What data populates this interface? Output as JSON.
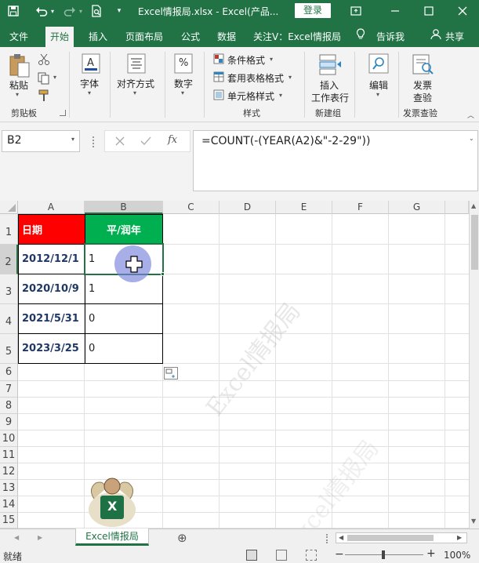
{
  "titlebar": {
    "title": "Excel情报局.xlsx  -  Excel(产品...",
    "login": "登录"
  },
  "tabs": [
    "文件",
    "开始",
    "插入",
    "页面布局",
    "公式",
    "数据",
    "关注V：Excel情报局",
    "告诉我",
    "共享"
  ],
  "ribbon": {
    "paste": "粘贴",
    "clipboard": "剪贴板",
    "font": "字体",
    "align": "对齐方式",
    "number": "数字",
    "number_glyph": "%",
    "cond_format": "条件格式",
    "table_format": "套用表格格式",
    "cell_style": "单元格样式",
    "styles": "样式",
    "insert_worksheet": "插入",
    "insert_worksheet2": "工作表行",
    "newbuild": "新建组",
    "edit": "编辑",
    "invoice1": "发票",
    "invoice2": "查验",
    "invoice_group": "发票查验"
  },
  "formula_bar": {
    "namebox": "B2",
    "formula": "=COUNT(-(YEAR(A2)&\"-2-29\"))"
  },
  "columns": [
    "A",
    "B",
    "C",
    "D",
    "E",
    "F",
    "G"
  ],
  "rows": [
    "1",
    "2",
    "3",
    "4",
    "5",
    "6",
    "7",
    "8",
    "9",
    "10",
    "11",
    "12",
    "13",
    "14",
    "15"
  ],
  "table": {
    "header_a": "日期",
    "header_b": "平/润年",
    "header_a_color": "#ff0000",
    "header_b_color": "#00b050",
    "dates": [
      "2012/12/1",
      "2020/10/9",
      "2021/5/31",
      "2023/3/25"
    ],
    "values": [
      "1",
      "1",
      "0",
      "0"
    ]
  },
  "watermark": "Excel情报局",
  "logo_text": "X",
  "sheet": {
    "name": "Excel情报局",
    "add": "⊕"
  },
  "status": {
    "ready": "就绪",
    "zoom": "100%",
    "minus": "−",
    "plus": "+"
  }
}
